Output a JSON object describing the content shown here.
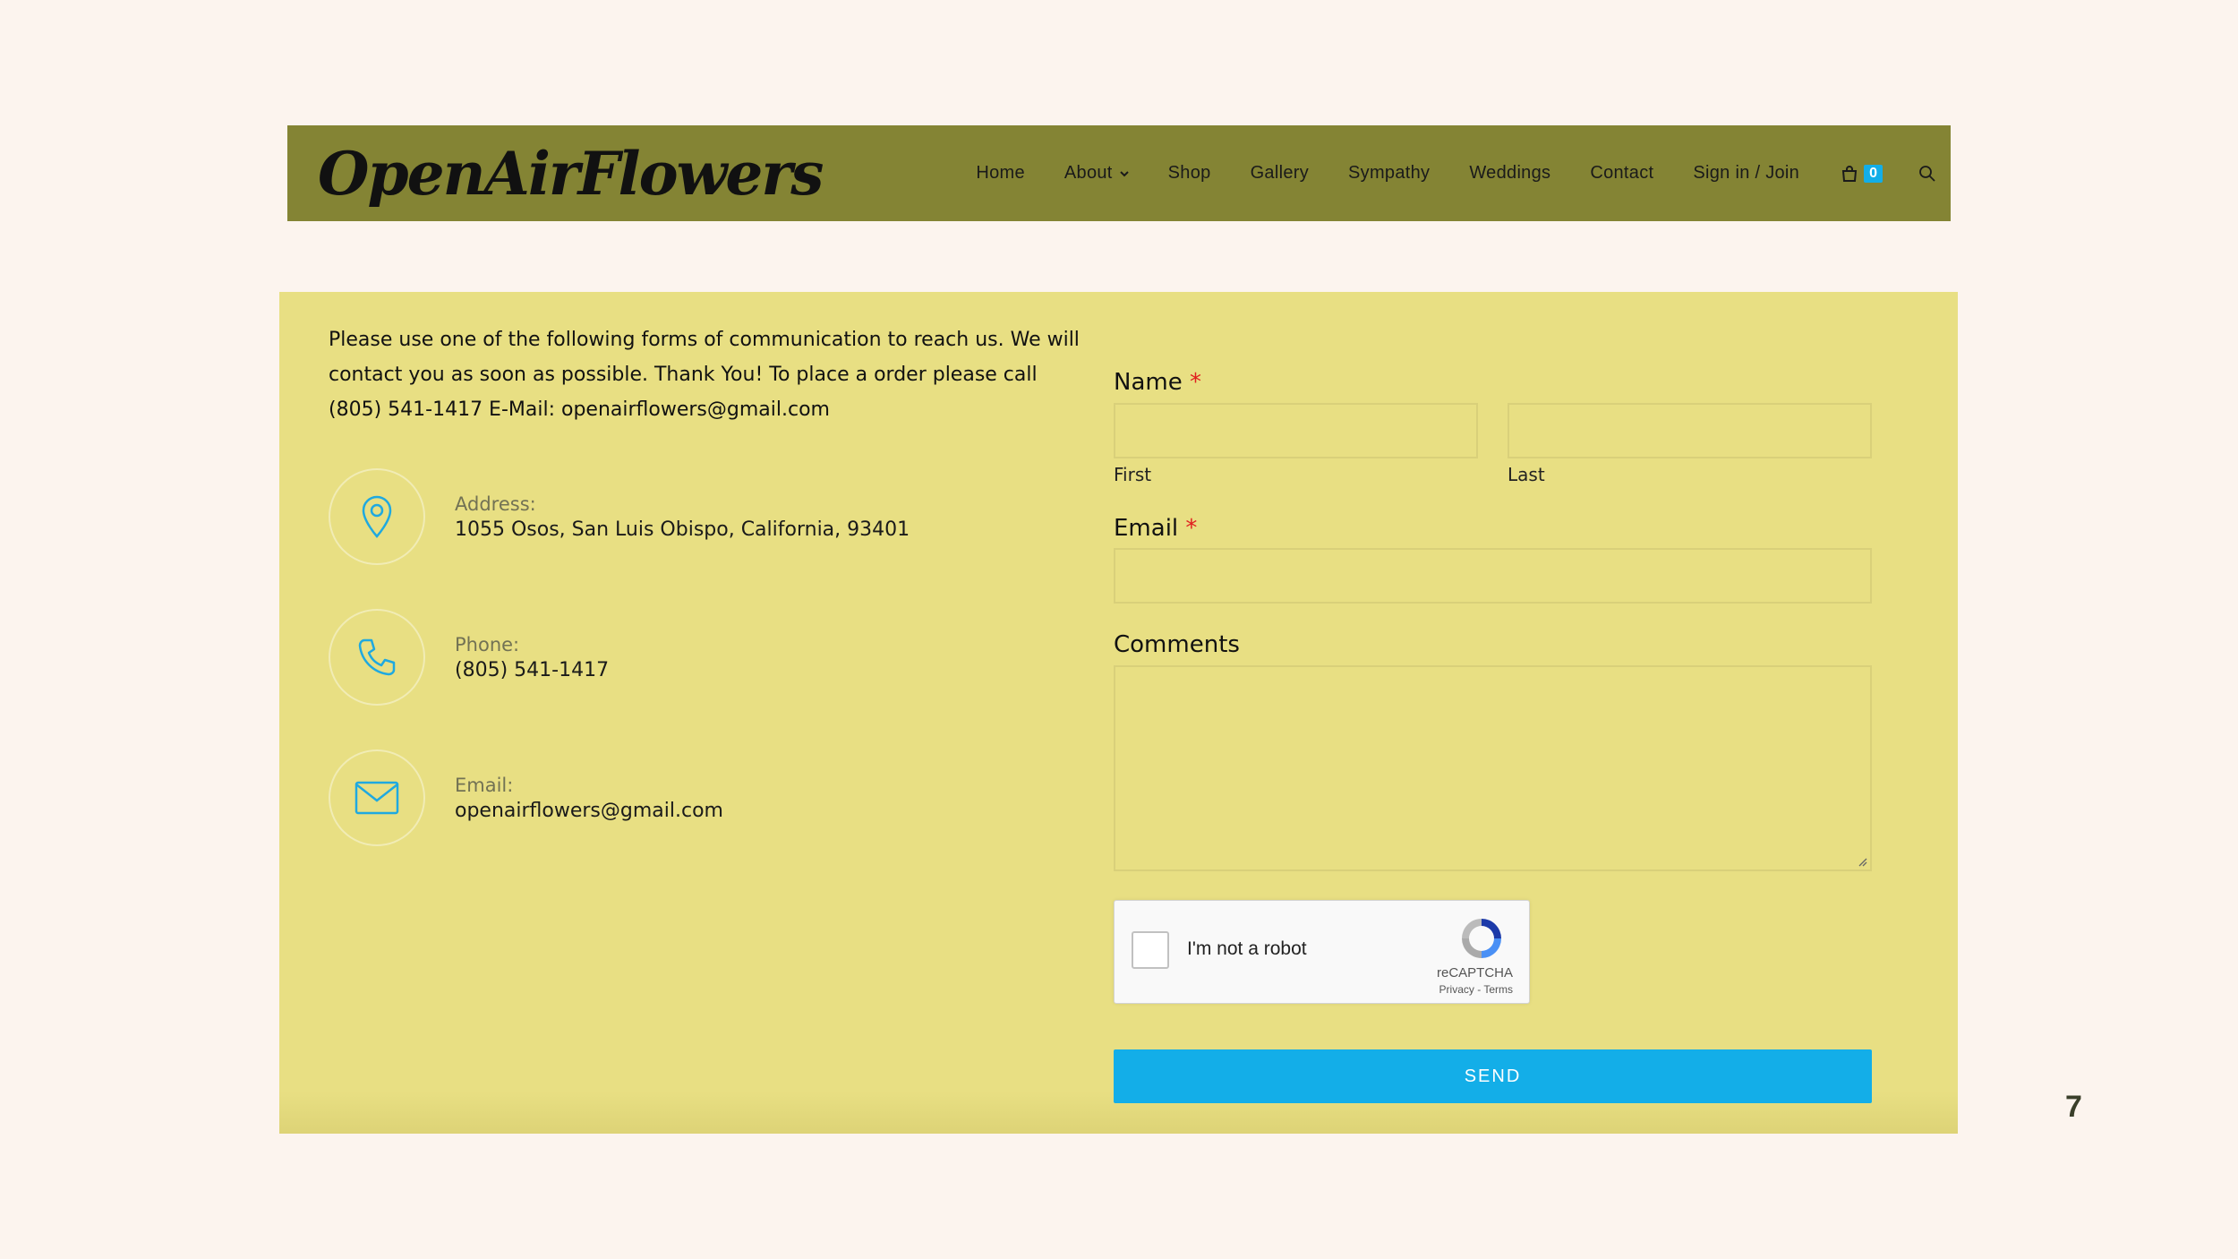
{
  "header": {
    "logo_text": "OpenAirFlowers",
    "nav": {
      "home": "Home",
      "about": "About",
      "shop": "Shop",
      "gallery": "Gallery",
      "sympathy": "Sympathy",
      "weddings": "Weddings",
      "contact": "Contact",
      "signin": "Sign in / Join"
    },
    "cart_count": "0",
    "colors": {
      "header_bg": "#848434",
      "badge": "#13aee8"
    }
  },
  "contact": {
    "intro": "Please use one of the following forms of communication to reach us. We will contact you as soon as possible. Thank You! To place a order please call (805) 541-1417 E-Mail: openairflowers@gmail.com",
    "address_label": "Address:",
    "address_value": "1055 Osos, San Luis Obispo, California, 93401",
    "phone_label": "Phone:",
    "phone_value": "(805) 541-1417",
    "email_label": "Email:",
    "email_value": "openairflowers@gmail.com",
    "icon_color": "#1fa9e0"
  },
  "form": {
    "name_label": "Name",
    "required_mark": "*",
    "first_label": "First",
    "last_label": "Last",
    "first_value": "",
    "last_value": "",
    "email_label": "Email",
    "email_value": "",
    "comments_label": "Comments",
    "comments_value": "",
    "captcha_text": "I'm not a robot",
    "captcha_brand": "reCAPTCHA",
    "captcha_terms": "Privacy - Terms",
    "send_label": "SEND"
  },
  "page_number": "7"
}
